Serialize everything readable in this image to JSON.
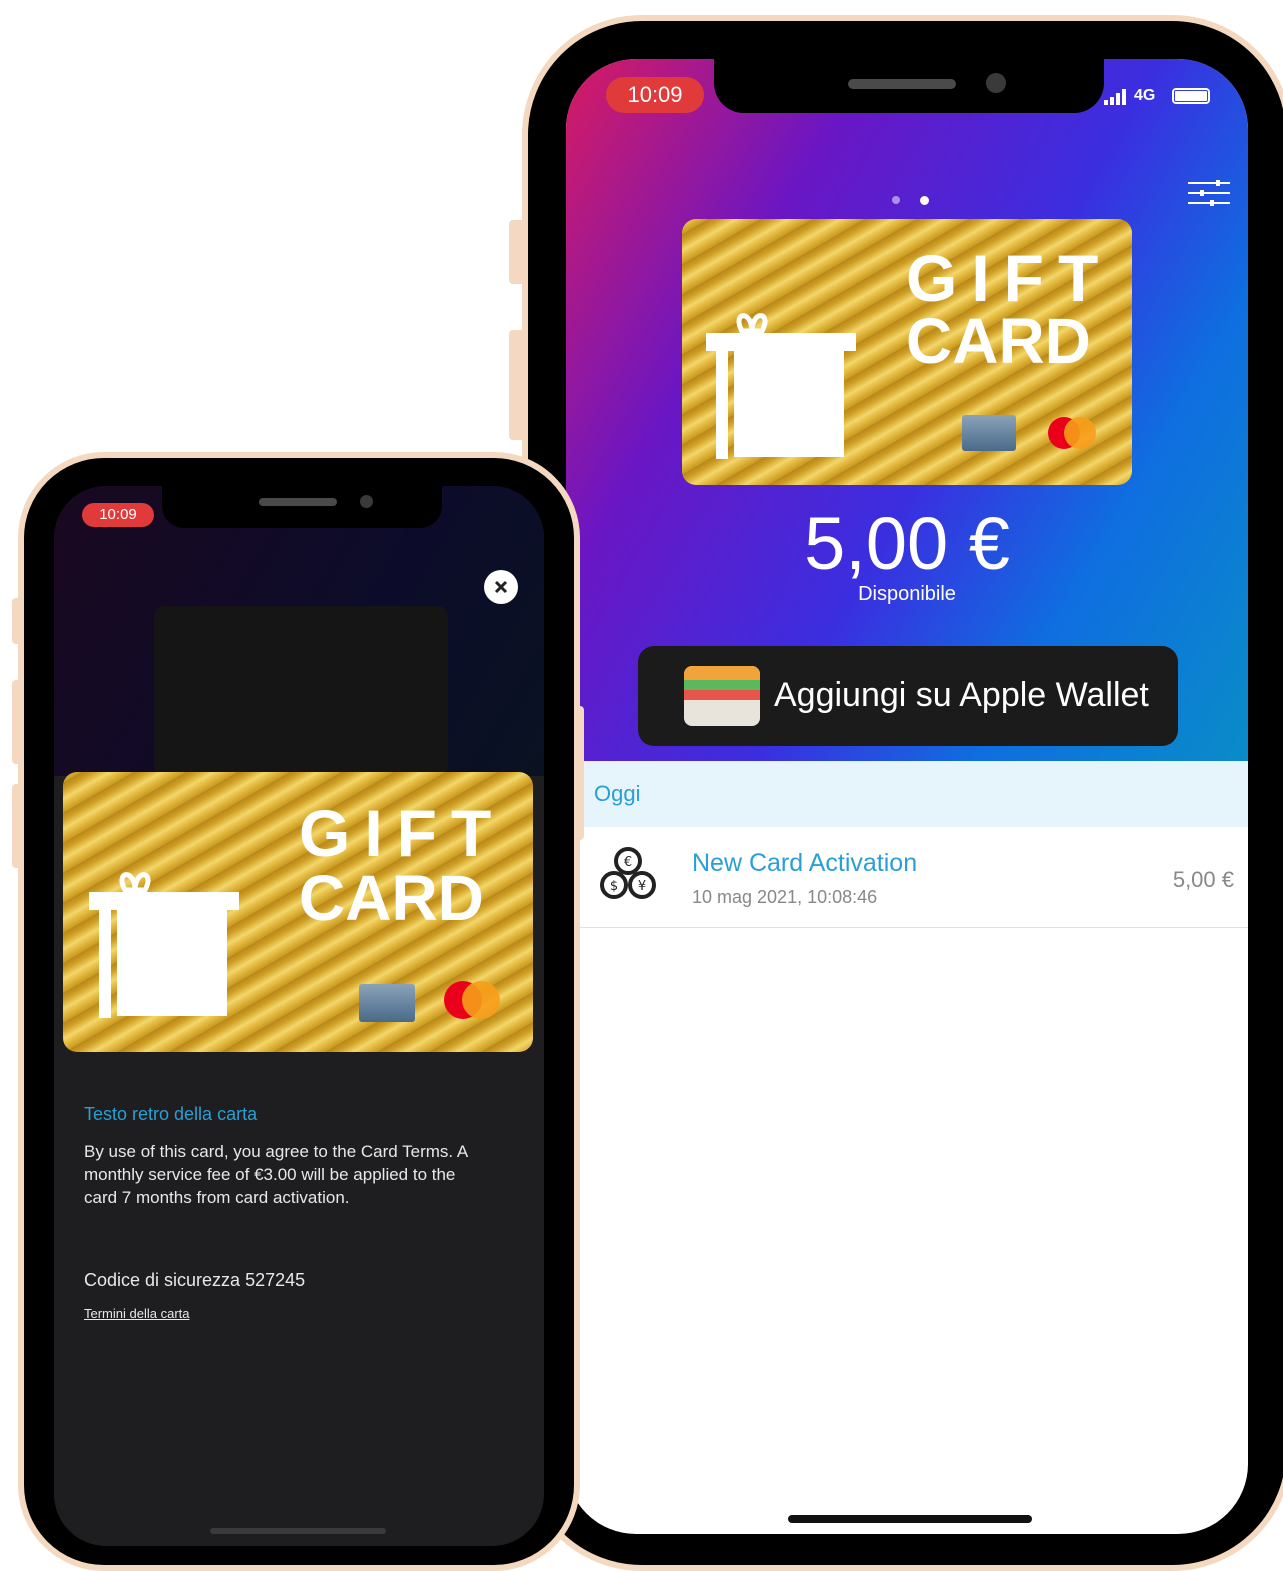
{
  "back_phone": {
    "status_time": "10:09",
    "network": "4G",
    "card": {
      "line1": "GIFT",
      "line2": "CARD"
    },
    "balance": "5,00 €",
    "balance_label": "Disponibile",
    "wallet_button": "Aggiungi su Apple Wallet",
    "section_header": "Oggi",
    "transaction": {
      "title": "New Card Activation",
      "date": "10 mag 2021, 10:08:46",
      "amount": "5,00 €"
    }
  },
  "front_phone": {
    "status_time": "10:09",
    "card": {
      "line1": "GIFT",
      "line2": "CARD"
    },
    "back_text_title": "Testo retro della carta",
    "back_text_body": "By use of this card, you agree to the Card Terms. A monthly service fee of €3.00 will be applied to the card 7 months from card activation.",
    "security_code": "Codice di sicurezza 527245",
    "terms_link": "Termini della carta"
  },
  "colors": {
    "frame": "#f4d9c0",
    "gradient_start": "#d81b60",
    "gradient_mid": "#5b1fd6",
    "gradient_end": "#0a8cc8",
    "accent_blue": "#2a9fd6",
    "time_pill": "#e03a3a"
  }
}
